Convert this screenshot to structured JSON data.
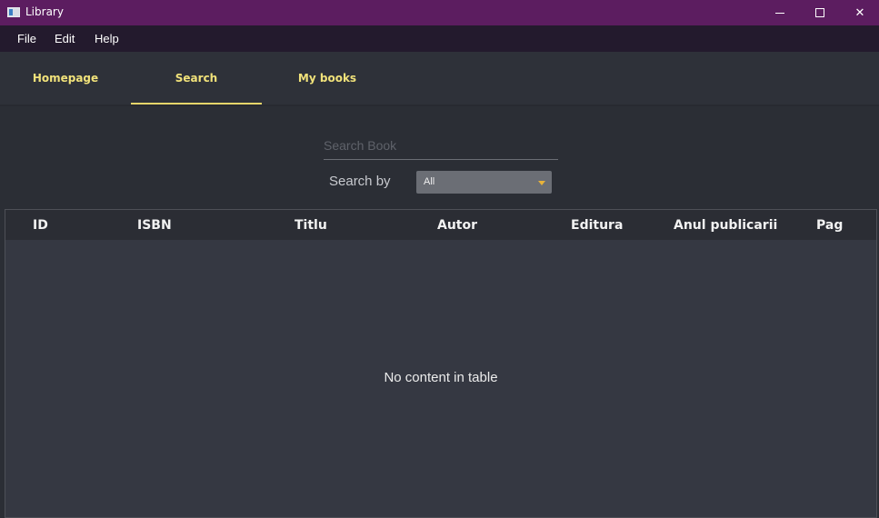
{
  "window": {
    "title": "Library",
    "minimize_icon": "minimize-icon",
    "maximize_icon": "maximize-icon",
    "close_icon": "close-icon",
    "close_glyph": "✕",
    "accent_color": "#5c1d60"
  },
  "menu": {
    "items": [
      "File",
      "Edit",
      "Help"
    ]
  },
  "tabs": {
    "items": [
      {
        "label": "Homepage",
        "active": false
      },
      {
        "label": "Search",
        "active": true
      },
      {
        "label": "My books",
        "active": false
      }
    ],
    "label_color": "#f1e27a"
  },
  "search": {
    "placeholder": "Search Book",
    "value": "",
    "search_by_label": "Search by",
    "search_by_selected": "All",
    "arrow_color": "#e8b33a"
  },
  "table": {
    "columns": [
      "ID",
      "ISBN",
      "Titlu",
      "Autor",
      "Editura",
      "Anul publicarii",
      "Pag"
    ],
    "rows": [],
    "empty_message": "No content in table"
  }
}
